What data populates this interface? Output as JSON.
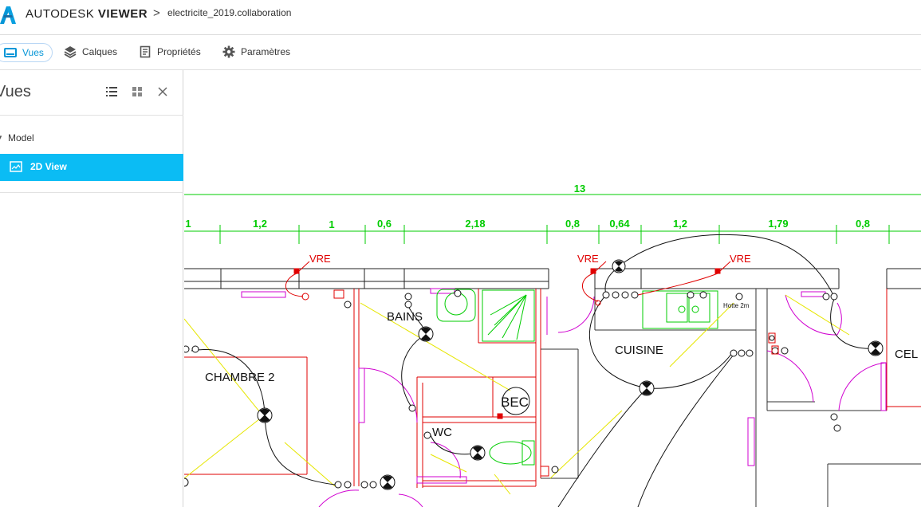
{
  "app": {
    "brand_light": "AUTODESK",
    "brand_bold": "VIEWER",
    "breadcrumb_sep": ">",
    "filename": "electricite_2019.collaboration"
  },
  "toolbar": {
    "items": [
      {
        "label": "Vues",
        "icon": "monitor-icon",
        "active": true
      },
      {
        "label": "Calques",
        "icon": "layers-icon"
      },
      {
        "label": "Propriétés",
        "icon": "document-icon"
      },
      {
        "label": "Paramètres",
        "icon": "gear-icon"
      }
    ]
  },
  "panel": {
    "title": "Vues",
    "tree": {
      "group": "Model",
      "selected": "2D View"
    }
  },
  "drawing": {
    "total_dimension": "13",
    "dimensions": [
      "1",
      "1,2",
      "1",
      "0,6",
      "2,18",
      "0,8",
      "0,64",
      "1,2",
      "1,79",
      "0,8"
    ],
    "rooms": [
      "CHAMBRE 2",
      "BAINS",
      "WC",
      "BEC",
      "CUISINE",
      "CEL"
    ],
    "labels": [
      "VRE",
      "VRE",
      "VRE",
      "Hotte 2m"
    ]
  },
  "colors": {
    "accent": "#0696d7",
    "selection": "#0bbcf4",
    "dimension": "#00cc00",
    "wall": "#222222",
    "red": "#e00000",
    "magenta": "#d000d0",
    "yellow": "#e6e600"
  }
}
